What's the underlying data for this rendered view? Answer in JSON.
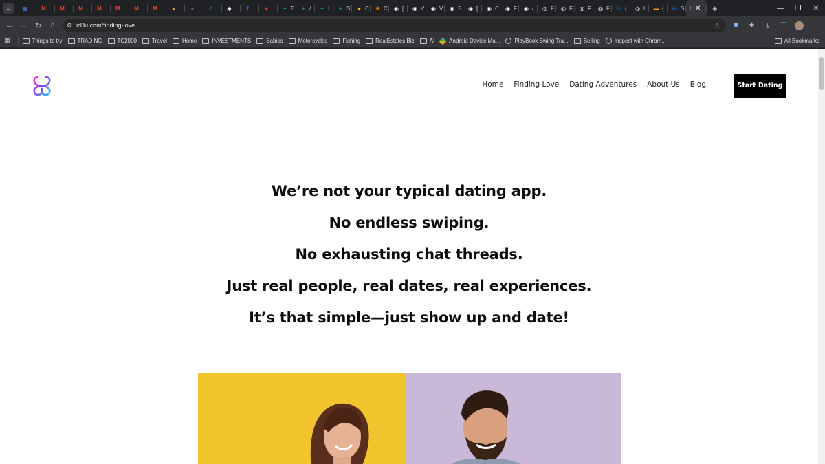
{
  "browser": {
    "tabs": [
      {
        "icon": "docs-icon",
        "color": "#4285f4",
        "glyph": "▦"
      },
      {
        "icon": "gmail-icon",
        "color": "#ea4335",
        "glyph": "M"
      },
      {
        "icon": "gmail-icon",
        "color": "#ea4335",
        "glyph": "M"
      },
      {
        "icon": "gmail-icon",
        "color": "#ea4335",
        "glyph": "M"
      },
      {
        "icon": "gmail-icon",
        "color": "#ea4335",
        "glyph": "M"
      },
      {
        "icon": "gmail-icon",
        "color": "#ea4335",
        "glyph": "M"
      },
      {
        "icon": "gmail-icon",
        "color": "#ea4335",
        "glyph": "M"
      },
      {
        "icon": "gmail-icon",
        "color": "#ea4335",
        "glyph": "M"
      },
      {
        "icon": "drive-icon",
        "color": "#fbbc05",
        "glyph": "▲"
      },
      {
        "icon": "audio-icon",
        "color": "#5f6368",
        "glyph": "◂"
      },
      {
        "icon": "chart-icon",
        "color": "#1a73e8",
        "glyph": "↗"
      },
      {
        "icon": "shield-icon",
        "color": "#e8eaed",
        "glyph": "◆"
      },
      {
        "icon": "facebook-icon",
        "color": "#1877f2",
        "glyph": "f"
      },
      {
        "icon": "red-icon",
        "color": "#d93025",
        "glyph": "■"
      },
      {
        "icon": "sheets-icon",
        "color": "#0f9d58",
        "glyph": "+",
        "label": "E"
      },
      {
        "icon": "sheets-icon",
        "color": "#0f9d58",
        "glyph": "+",
        "label": "/"
      },
      {
        "icon": "sheets-icon",
        "color": "#0f9d58",
        "glyph": "+",
        "label": "I"
      },
      {
        "icon": "sheets-icon",
        "color": "#0f9d58",
        "glyph": "+",
        "label": "S"
      },
      {
        "icon": "yellow-circle-icon",
        "color": "#fbbc05",
        "glyph": "●",
        "label": "C"
      },
      {
        "icon": "star-burst-icon",
        "color": "#e8710a",
        "glyph": "✺",
        "label": "C"
      },
      {
        "icon": "github-icon",
        "color": "#e8eaed",
        "glyph": "◉",
        "label": "["
      },
      {
        "icon": "github-icon",
        "color": "#e8eaed",
        "glyph": "◉",
        "label": "V"
      },
      {
        "icon": "github-icon",
        "color": "#e8eaed",
        "glyph": "◉",
        "label": "V"
      },
      {
        "icon": "github-icon",
        "color": "#e8eaed",
        "glyph": "◉",
        "label": "S"
      },
      {
        "icon": "github-icon",
        "color": "#e8eaed",
        "glyph": "◉",
        "label": "["
      },
      {
        "icon": "github-icon",
        "color": "#e8eaed",
        "glyph": "◉",
        "label": "C"
      },
      {
        "icon": "github-icon",
        "color": "#e8eaed",
        "glyph": "◉",
        "label": "F"
      },
      {
        "icon": "github-icon",
        "color": "#e8eaed",
        "glyph": "◉",
        "label": "/"
      },
      {
        "icon": "globe-icon",
        "color": "#e8eaed",
        "glyph": "◎",
        "label": "F"
      },
      {
        "icon": "globe-icon",
        "color": "#e8eaed",
        "glyph": "◎",
        "label": "F"
      },
      {
        "icon": "globe-icon",
        "color": "#e8eaed",
        "glyph": "◎",
        "label": "F"
      },
      {
        "icon": "globe-icon",
        "color": "#e8eaed",
        "glyph": "◎",
        "label": "F"
      },
      {
        "icon": "linkedin-icon",
        "color": "#0a66c2",
        "glyph": "in",
        "label": "("
      },
      {
        "icon": "globe-icon",
        "color": "#e8eaed",
        "glyph": "◎",
        "label": "I"
      },
      {
        "icon": "flag-icon",
        "color": "#f9ab00",
        "glyph": "▬",
        "label": "("
      },
      {
        "icon": "linkedin-icon",
        "color": "#0a66c2",
        "glyph": "in",
        "label": "S"
      }
    ],
    "active_tab_label": "I",
    "tab_close": "✕",
    "new_tab": "+",
    "window_controls": {
      "minimize": "—",
      "restore": "❐",
      "close": "✕"
    },
    "url": "id8u.com/finding-love",
    "bookmarks": [
      {
        "label": "Things to try",
        "kind": "folder"
      },
      {
        "label": "TRADING",
        "kind": "folder"
      },
      {
        "label": "TC2000",
        "kind": "folder"
      },
      {
        "label": "Travel",
        "kind": "folder"
      },
      {
        "label": "Home",
        "kind": "folder"
      },
      {
        "label": "INVESTMENTS",
        "kind": "folder"
      },
      {
        "label": "Babies",
        "kind": "folder"
      },
      {
        "label": "Motorcycles",
        "kind": "folder"
      },
      {
        "label": "Fishing",
        "kind": "folder"
      },
      {
        "label": "RealEstates Biz",
        "kind": "folder"
      },
      {
        "label": "AI",
        "kind": "folder"
      },
      {
        "label": "Android Device Ma...",
        "kind": "diamond"
      },
      {
        "label": "PlayBook Swing Tra...",
        "kind": "globe"
      },
      {
        "label": "Selling",
        "kind": "folder"
      },
      {
        "label": "Inspect with Chrom...",
        "kind": "globe"
      }
    ],
    "all_bookmarks": "All Bookmarks"
  },
  "site": {
    "nav": [
      "Home",
      "Finding Love",
      "Dating Adventures",
      "About Us",
      "Blog"
    ],
    "current_nav": "Finding Love",
    "cta": "Start Dating",
    "headlines": [
      "We’re not your typical dating app.",
      "No endless swiping.",
      "No exhausting chat threads.",
      "Just real people, real dates, real experiences.",
      "It’s that simple—just show up and date!"
    ],
    "hero": {
      "left_bg": "#f2c42e",
      "right_bg": "#cab8d8"
    }
  }
}
